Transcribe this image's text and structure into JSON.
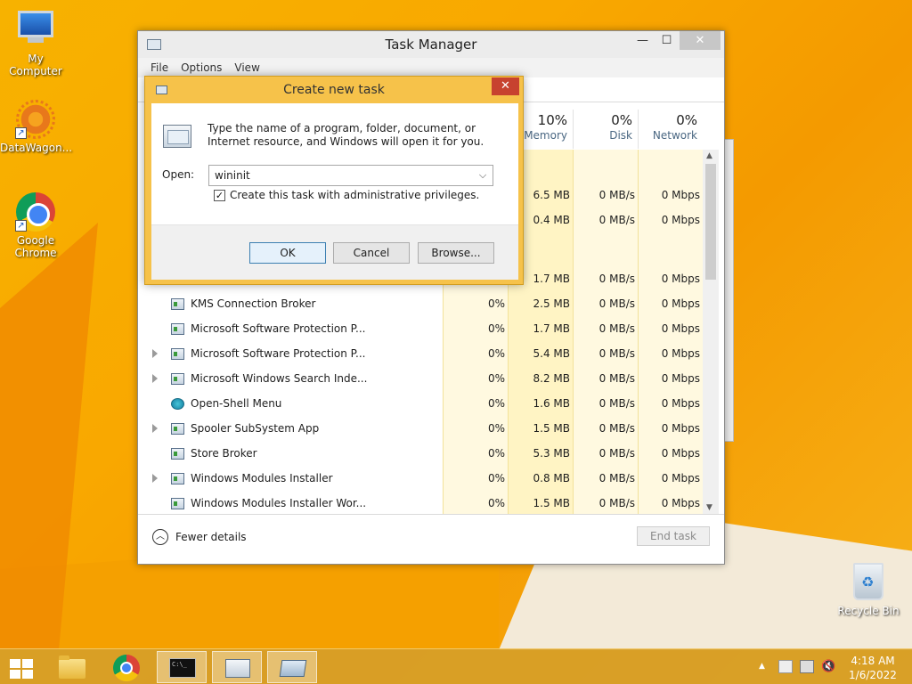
{
  "desktop": {
    "icons": [
      {
        "label": "My Computer"
      },
      {
        "label": "DataWagon..."
      },
      {
        "label": "Google Chrome"
      },
      {
        "label": "Recycle Bin"
      }
    ]
  },
  "task_manager": {
    "title": "Task Manager",
    "menu": [
      "File",
      "Options",
      "View"
    ],
    "columns": [
      {
        "pct": "10%",
        "label": "Memory"
      },
      {
        "pct": "0%",
        "label": "Disk"
      },
      {
        "pct": "0%",
        "label": "Network"
      }
    ],
    "partial_rows": [
      {
        "memory": "6.5 MB",
        "disk": "0 MB/s",
        "network": "0 Mbps"
      },
      {
        "memory": "0.4 MB",
        "disk": "0 MB/s",
        "network": "0 Mbps"
      },
      {
        "memory": "1.7 MB",
        "disk": "0 MB/s",
        "network": "0 Mbps"
      }
    ],
    "rows": [
      {
        "name": "KMS Connection Broker",
        "cpu": "0%",
        "memory": "2.5 MB",
        "disk": "0 MB/s",
        "network": "0 Mbps",
        "expandable": false
      },
      {
        "name": "Microsoft Software Protection P...",
        "cpu": "0%",
        "memory": "1.7 MB",
        "disk": "0 MB/s",
        "network": "0 Mbps",
        "expandable": false
      },
      {
        "name": "Microsoft Software Protection P...",
        "cpu": "0%",
        "memory": "5.4 MB",
        "disk": "0 MB/s",
        "network": "0 Mbps",
        "expandable": true
      },
      {
        "name": "Microsoft Windows Search Inde...",
        "cpu": "0%",
        "memory": "8.2 MB",
        "disk": "0 MB/s",
        "network": "0 Mbps",
        "expandable": true
      },
      {
        "name": "Open-Shell Menu",
        "cpu": "0%",
        "memory": "1.6 MB",
        "disk": "0 MB/s",
        "network": "0 Mbps",
        "expandable": false
      },
      {
        "name": "Spooler SubSystem App",
        "cpu": "0%",
        "memory": "1.5 MB",
        "disk": "0 MB/s",
        "network": "0 Mbps",
        "expandable": true
      },
      {
        "name": "Store Broker",
        "cpu": "0%",
        "memory": "5.3 MB",
        "disk": "0 MB/s",
        "network": "0 Mbps",
        "expandable": false
      },
      {
        "name": "Windows Modules Installer",
        "cpu": "0%",
        "memory": "0.8 MB",
        "disk": "0 MB/s",
        "network": "0 Mbps",
        "expandable": true
      },
      {
        "name": "Windows Modules Installer Wor...",
        "cpu": "0%",
        "memory": "1.5 MB",
        "disk": "0 MB/s",
        "network": "0 Mbps",
        "expandable": false
      }
    ],
    "footer": {
      "fewer_details": "Fewer details",
      "end_task": "End task"
    }
  },
  "dialog": {
    "title": "Create new task",
    "close": "✕",
    "description": "Type the name of a program, folder, document, or Internet resource, and Windows will open it for you.",
    "open_label": "Open:",
    "open_value": "wininit",
    "admin_checkbox_label": "Create this task with administrative privileges.",
    "admin_checked": true,
    "buttons": {
      "ok": "OK",
      "cancel": "Cancel",
      "browse": "Browse..."
    }
  },
  "taskbar": {
    "items": [
      "start-icon",
      "file-explorer-icon",
      "chrome-icon",
      "command-prompt-icon",
      "task-manager-icon",
      "run-dialog-icon"
    ],
    "clock": {
      "time": "4:18 AM",
      "date": "1/6/2022"
    },
    "accent": "#d69e28"
  }
}
